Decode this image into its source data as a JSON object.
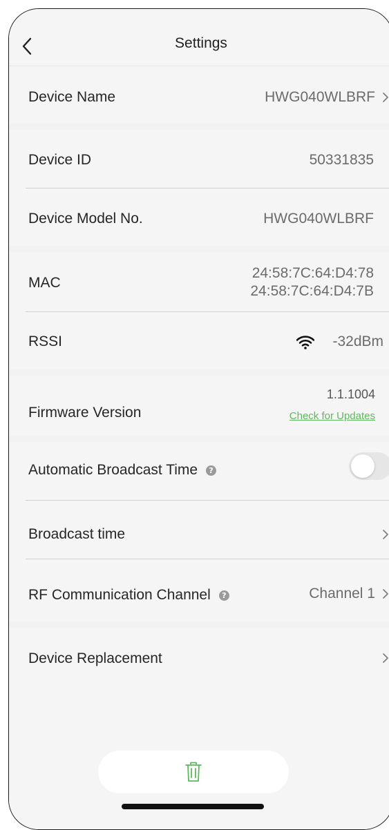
{
  "header": {
    "title": "Settings"
  },
  "rows": {
    "device_name": {
      "label": "Device Name",
      "value": "HWG040WLBRF"
    },
    "device_id": {
      "label": "Device ID",
      "value": "50331835"
    },
    "model_no": {
      "label": "Device Model No.",
      "value": "HWG040WLBRF"
    },
    "mac": {
      "label": "MAC",
      "value1": "24:58:7C:64:D4:78",
      "value2": "24:58:7C:64:D4:7B"
    },
    "rssi": {
      "label": "RSSI",
      "value": "-32dBm"
    },
    "firmware": {
      "label": "Firmware Version",
      "value": "1.1.1004",
      "link": "Check for Updates"
    },
    "auto_broadcast": {
      "label": "Automatic Broadcast Time",
      "enabled": false
    },
    "broadcast_time": {
      "label": "Broadcast time"
    },
    "rf_channel": {
      "label": "RF Communication Channel",
      "value": "Channel 1"
    },
    "replacement": {
      "label": "Device Replacement"
    }
  },
  "colors": {
    "accent": "#5cb85c",
    "background": "#f2f2f2",
    "section": "#f5f5f5"
  },
  "icons": {
    "back": "chevron-left-icon",
    "chevron": "chevron-right-icon",
    "wifi": "wifi-icon",
    "help": "help-icon",
    "delete": "trash-icon"
  }
}
